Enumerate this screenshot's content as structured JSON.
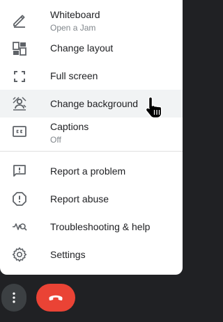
{
  "menu": {
    "items": [
      {
        "label": "Whiteboard",
        "sub": "Open a Jam",
        "icon": "pencil-icon"
      },
      {
        "label": "Change layout",
        "icon": "layout-icon"
      },
      {
        "label": "Full screen",
        "icon": "fullscreen-icon"
      },
      {
        "label": "Change background",
        "icon": "background-effects-icon"
      },
      {
        "label": "Captions",
        "sub": "Off",
        "icon": "captions-icon"
      },
      {
        "label": "Report a problem",
        "icon": "feedback-icon"
      },
      {
        "label": "Report abuse",
        "icon": "report-icon"
      },
      {
        "label": "Troubleshooting & help",
        "icon": "troubleshoot-icon"
      },
      {
        "label": "Settings",
        "icon": "gear-icon"
      }
    ]
  },
  "colors": {
    "hangup": "#ea4335",
    "bar": "#202124",
    "hover": "#f1f3f4",
    "icon": "#5f6368"
  }
}
